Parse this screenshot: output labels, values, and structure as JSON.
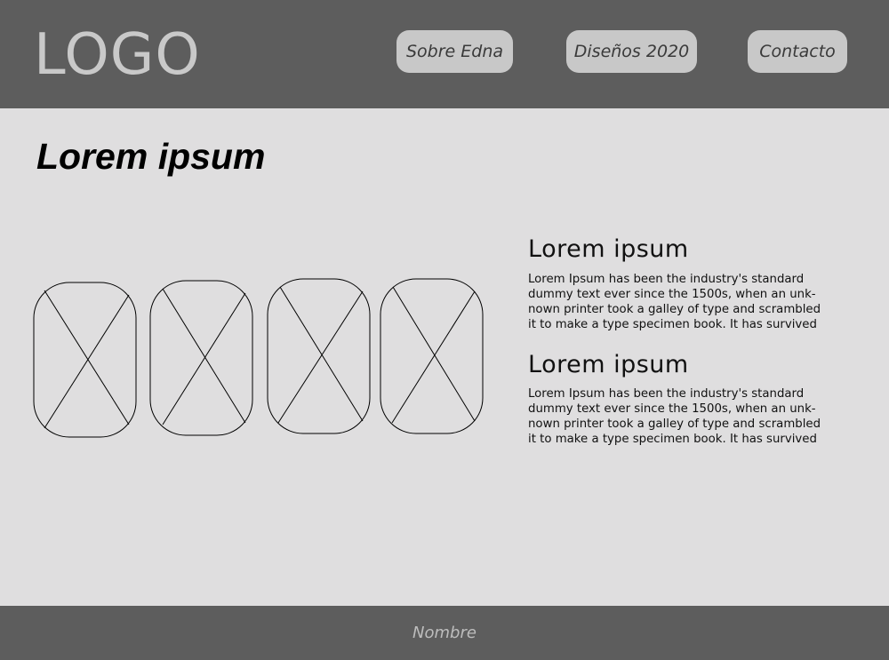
{
  "header": {
    "logo": "LOGO",
    "nav": [
      "Sobre Edna",
      "Diseños 2020",
      "Contacto"
    ]
  },
  "main": {
    "title": "Lorem ipsum",
    "gallery": {
      "image_icon": "image-placeholder-icon",
      "count": 4
    },
    "sections": [
      {
        "title": "Lorem ipsum",
        "body": "Lorem Ipsum has been the industry's standard\ndummy text ever since the 1500s, when an unk-\nnown printer took a galley of type and scrambled\nit to make a type specimen book. It has survived"
      },
      {
        "title": "Lorem ipsum",
        "body": "Lorem Ipsum has been the industry's standard\ndummy text ever since the 1500s, when an unk-\nnown printer took a galley of type and scrambled\nit to make a type specimen book. It has survived"
      }
    ]
  },
  "footer": {
    "text": "Nombre"
  },
  "colors": {
    "header_bg": "#5d5d5d",
    "page_bg": "#dfdedf",
    "button_bg": "#c8c8c8"
  }
}
